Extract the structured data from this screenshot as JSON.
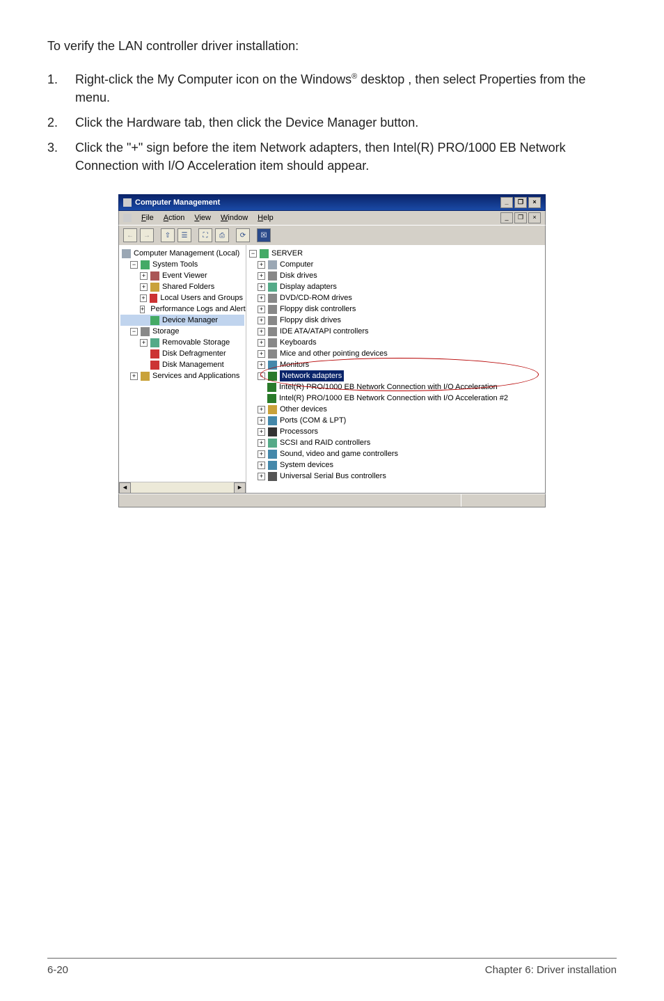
{
  "intro": "To verify the LAN controller driver installation:",
  "steps": [
    {
      "num": "1.",
      "before": "Right-click the My Computer icon on the Windows",
      "sup": "®",
      "after": " desktop , then select Properties from the menu."
    },
    {
      "num": "2.",
      "before": "Click the Hardware tab, then click the Device Manager button.",
      "sup": "",
      "after": ""
    },
    {
      "num": "3.",
      "before": "Click the \"+\" sign before the item Network adapters, then Intel(R) PRO/1000 EB Network Connection with I/O Acceleration item should appear.",
      "sup": "",
      "after": ""
    }
  ],
  "window": {
    "title": "Computer Management",
    "controls": {
      "min": "_",
      "max": "❐",
      "close": "×"
    },
    "child_controls": {
      "min": "_",
      "max": "❐",
      "close": "×"
    },
    "menu": {
      "file": "File",
      "action": "Action",
      "view": "View",
      "window": "Window",
      "help": "Help"
    },
    "toolbar": {
      "back": "←",
      "fwd": "→",
      "up1": "⇧",
      "up2": "☰",
      "prop": "⛶",
      "print": "⎙",
      "refresh": "⟳",
      "x": "☒"
    }
  },
  "left_tree": {
    "root": "Computer Management (Local)",
    "systools": "System Tools",
    "event": "Event Viewer",
    "shared": "Shared Folders",
    "users": "Local Users and Groups",
    "perf": "Performance Logs and Alerts",
    "devmgr": "Device Manager",
    "storage": "Storage",
    "rem": "Removable Storage",
    "defrag": "Disk Defragmenter",
    "diskmgmt": "Disk Management",
    "services": "Services and Applications"
  },
  "right_tree": {
    "server": "SERVER",
    "computer": "Computer",
    "disk": "Disk drives",
    "display": "Display adapters",
    "dvd": "DVD/CD-ROM drives",
    "floppyctrl": "Floppy disk controllers",
    "floppy": "Floppy disk drives",
    "ide": "IDE ATA/ATAPI controllers",
    "kb": "Keyboards",
    "mouse": "Mice and other pointing devices",
    "mon": "Monitors",
    "net": "Network adapters",
    "net1": "Intel(R) PRO/1000 EB Network Connection with I/O Acceleration",
    "net2": "Intel(R) PRO/1000 EB Network Connection with I/O Acceleration #2",
    "other": "Other devices",
    "ports": "Ports (COM & LPT)",
    "cpu": "Processors",
    "scsi": "SCSI and RAID controllers",
    "sound": "Sound, video and game controllers",
    "sys": "System devices",
    "usb": "Universal Serial Bus controllers"
  },
  "scroll": {
    "left": "◄",
    "right": "►"
  },
  "footer": {
    "left": "6-20",
    "right": "Chapter 6: Driver installation"
  }
}
